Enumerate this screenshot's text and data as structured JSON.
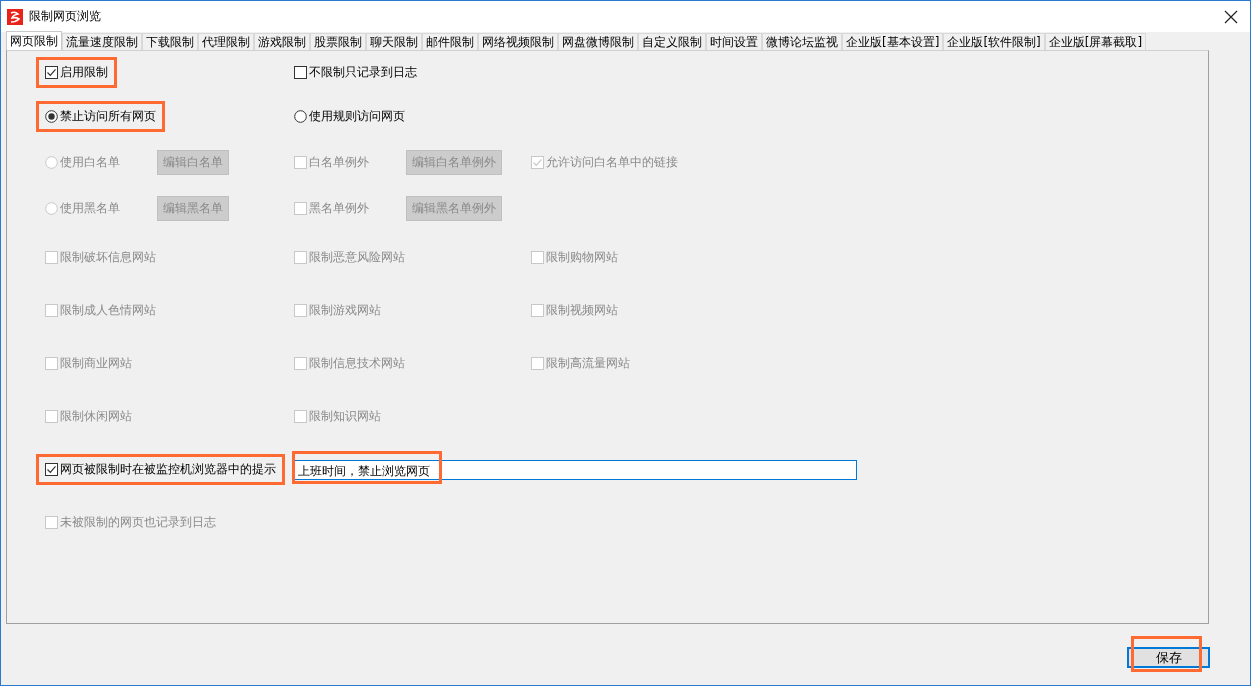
{
  "window": {
    "title": "限制网页浏览"
  },
  "tabs": [
    {
      "label": "网页限制",
      "selected": true
    },
    {
      "label": "流量速度限制",
      "selected": false
    },
    {
      "label": "下载限制",
      "selected": false
    },
    {
      "label": "代理限制",
      "selected": false
    },
    {
      "label": "游戏限制",
      "selected": false
    },
    {
      "label": "股票限制",
      "selected": false
    },
    {
      "label": "聊天限制",
      "selected": false
    },
    {
      "label": "邮件限制",
      "selected": false
    },
    {
      "label": "网络视频限制",
      "selected": false
    },
    {
      "label": "网盘微博限制",
      "selected": false
    },
    {
      "label": "自定义限制",
      "selected": false
    },
    {
      "label": "时间设置",
      "selected": false
    },
    {
      "label": "微博论坛监视",
      "selected": false
    },
    {
      "label": "企业版[基本设置]",
      "selected": false
    },
    {
      "label": "企业版[软件限制]",
      "selected": false
    },
    {
      "label": "企业版[屏幕截取]",
      "selected": false
    }
  ],
  "rows": [
    {
      "column_1": [
        {
          "kind": "checkbox",
          "label": "启用限制",
          "checked": true,
          "disabled": false,
          "highlighted": true
        }
      ],
      "column_2": [
        {
          "kind": "checkbox",
          "label": "不限制只记录到日志",
          "checked": false,
          "disabled": false,
          "highlighted": false
        }
      ]
    },
    {
      "column_1": [
        {
          "kind": "radio",
          "label": "禁止访问所有网页",
          "checked": true,
          "disabled": false,
          "highlighted": true
        }
      ],
      "column_2": [
        {
          "kind": "radio",
          "label": "使用规则访问网页",
          "checked": false,
          "disabled": false,
          "highlighted": false
        }
      ]
    },
    {
      "column_1": [
        {
          "kind": "radio",
          "label": "使用白名单",
          "checked": false,
          "disabled": true,
          "highlighted": false
        },
        {
          "kind": "button",
          "label": "编辑白名单",
          "disabled": true
        }
      ],
      "column_2": [
        {
          "kind": "checkbox",
          "label": "白名单例外",
          "checked": false,
          "disabled": true,
          "highlighted": false
        },
        {
          "kind": "button",
          "label": "编辑白名单例外",
          "disabled": true
        }
      ],
      "column_3": [
        {
          "kind": "checkbox",
          "label": "允许访问白名单中的链接",
          "checked": true,
          "disabled": true,
          "highlighted": false
        }
      ]
    },
    {
      "column_1": [
        {
          "kind": "radio",
          "label": "使用黑名单",
          "checked": false,
          "disabled": true,
          "highlighted": false
        },
        {
          "kind": "button",
          "label": "编辑黑名单",
          "disabled": true
        }
      ],
      "column_2": [
        {
          "kind": "checkbox",
          "label": "黑名单例外",
          "checked": false,
          "disabled": true,
          "highlighted": false
        },
        {
          "kind": "button",
          "label": "编辑黑名单例外",
          "disabled": true
        }
      ]
    },
    {
      "column_1": [
        {
          "kind": "checkbox",
          "label": "限制破坏信息网站",
          "checked": false,
          "disabled": true,
          "highlighted": false
        }
      ],
      "column_2": [
        {
          "kind": "checkbox",
          "label": "限制恶意风险网站",
          "checked": false,
          "disabled": true,
          "highlighted": false
        }
      ],
      "column_3": [
        {
          "kind": "checkbox",
          "label": "限制购物网站",
          "checked": false,
          "disabled": true,
          "highlighted": false
        }
      ]
    },
    {
      "column_1": [
        {
          "kind": "checkbox",
          "label": "限制成人色情网站",
          "checked": false,
          "disabled": true,
          "highlighted": false
        }
      ],
      "column_2": [
        {
          "kind": "checkbox",
          "label": "限制游戏网站",
          "checked": false,
          "disabled": true,
          "highlighted": false
        }
      ],
      "column_3": [
        {
          "kind": "checkbox",
          "label": "限制视频网站",
          "checked": false,
          "disabled": true,
          "highlighted": false
        }
      ]
    },
    {
      "column_1": [
        {
          "kind": "checkbox",
          "label": "限制商业网站",
          "checked": false,
          "disabled": true,
          "highlighted": false
        }
      ],
      "column_2": [
        {
          "kind": "checkbox",
          "label": "限制信息技术网站",
          "checked": false,
          "disabled": true,
          "highlighted": false
        }
      ],
      "column_3": [
        {
          "kind": "checkbox",
          "label": "限制高流量网站",
          "checked": false,
          "disabled": true,
          "highlighted": false
        }
      ]
    },
    {
      "column_1": [
        {
          "kind": "checkbox",
          "label": "限制休闲网站",
          "checked": false,
          "disabled": true,
          "highlighted": false
        }
      ],
      "column_2": [
        {
          "kind": "checkbox",
          "label": "限制知识网站",
          "checked": false,
          "disabled": true,
          "highlighted": false
        }
      ]
    },
    {
      "column_1": [
        {
          "kind": "checkbox",
          "label": "网页被限制时在被监控机浏览器中的提示",
          "checked": true,
          "disabled": false,
          "highlighted": true
        }
      ],
      "column_2": [
        {
          "kind": "field",
          "value": "上班时间，禁止浏览网页",
          "highlighted": true
        }
      ]
    },
    {
      "column_1": [
        {
          "kind": "checkbox",
          "label": "未被限制的网页也记录到日志",
          "checked": false,
          "disabled": true,
          "highlighted": false
        }
      ]
    }
  ],
  "save_button": {
    "label": "保存",
    "highlighted": true
  }
}
